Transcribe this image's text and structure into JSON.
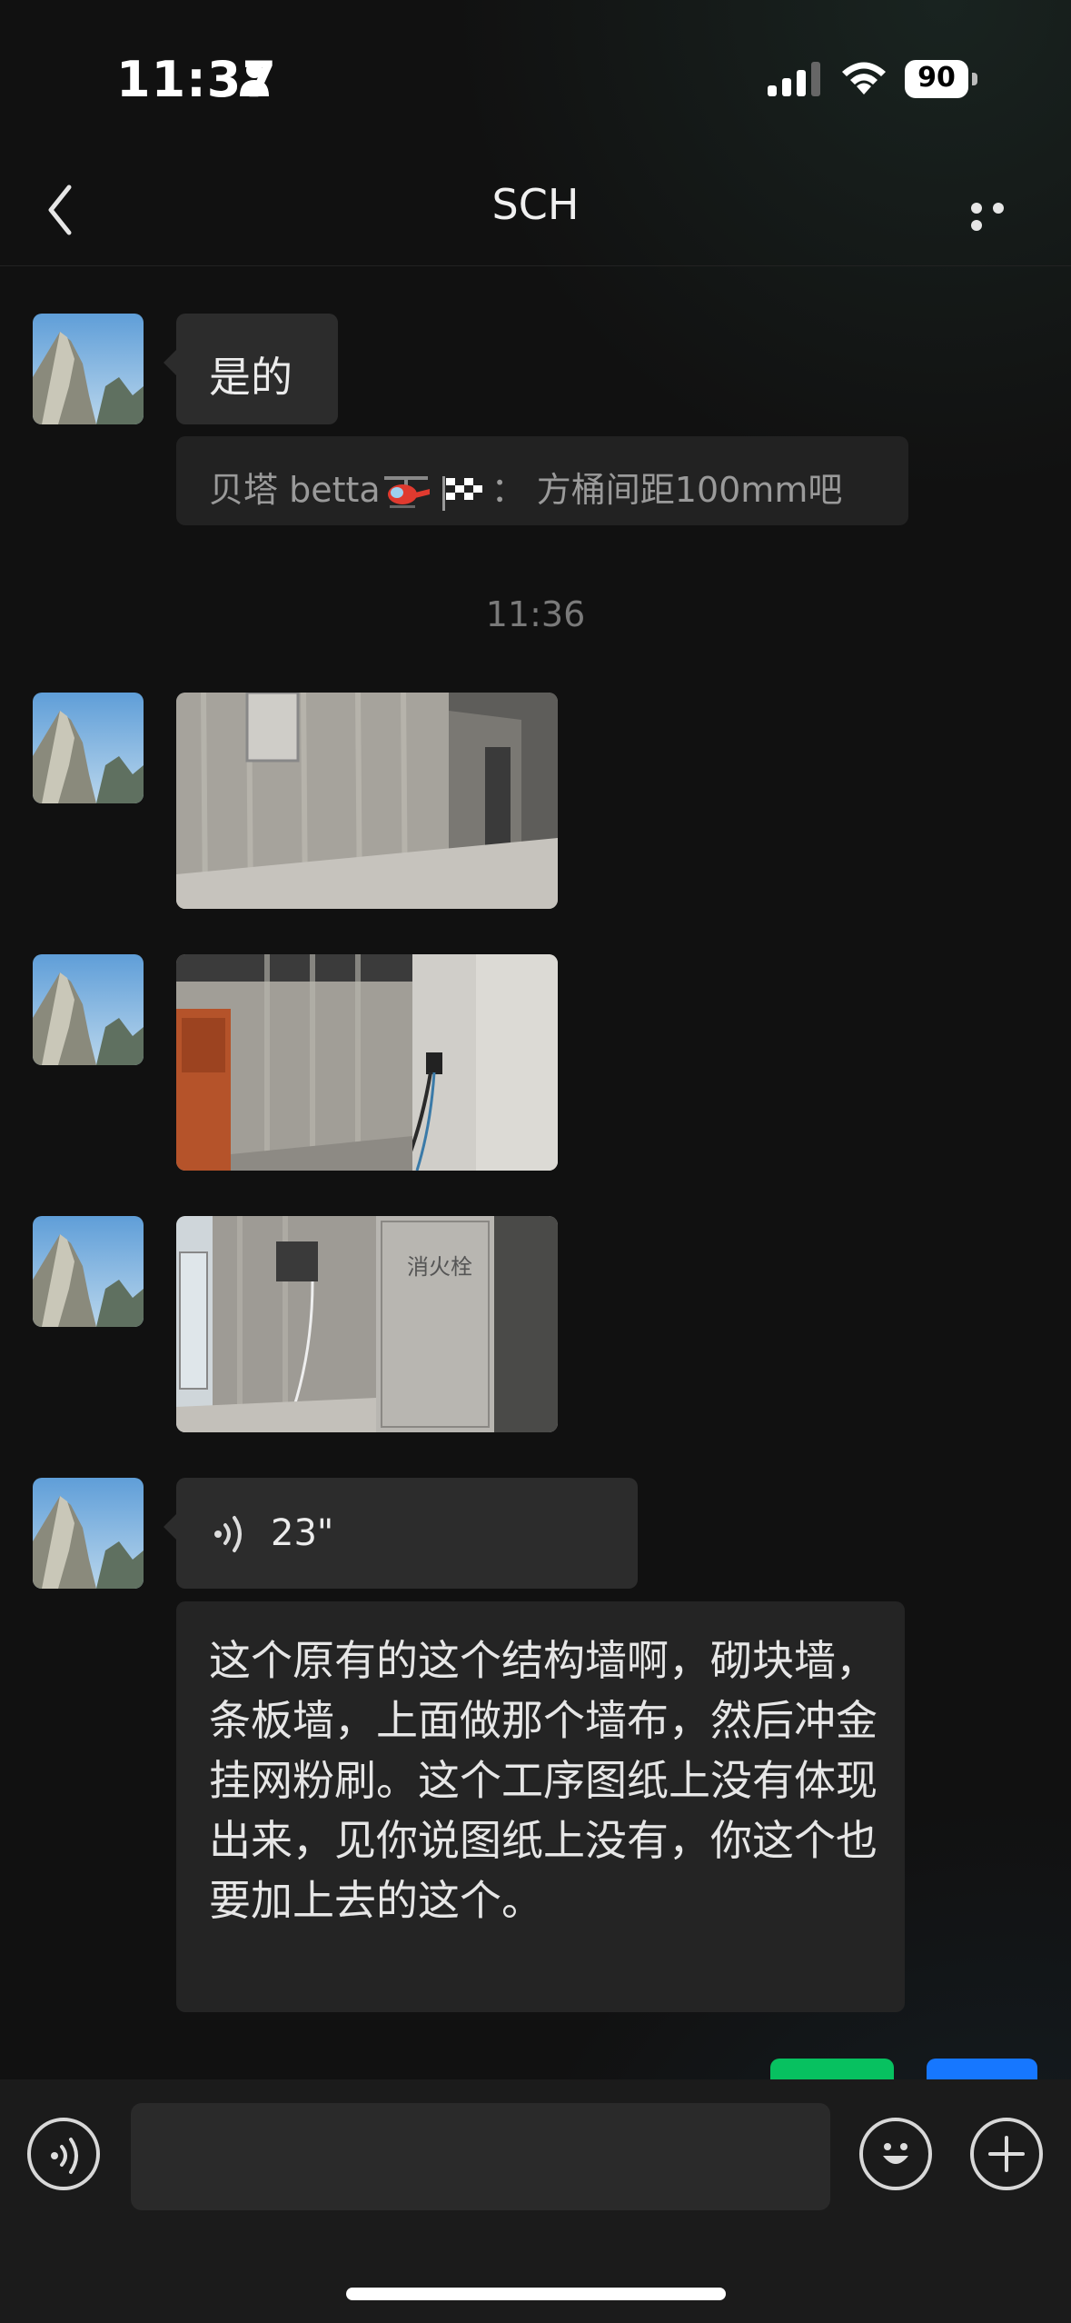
{
  "status_bar": {
    "time": "11:37",
    "battery": "90"
  },
  "nav": {
    "title": "SCH"
  },
  "messages": {
    "text1": "是的",
    "quote": {
      "sender": "贝塔 betta",
      "text": "方桶间距100mm吧"
    },
    "timestamp": "11:36",
    "voice_duration": "23\"",
    "transcript": "这个原有的这个结构墙啊，砌块墙，条板墙，上面做那个墙布，然后冲金挂网粉刷。这个工序图纸上没有体现出来，见你说图纸上没有，你这个也要加上去的这个。"
  },
  "photo3_sign": "消火栓",
  "colors": {
    "background": "#111111",
    "bubble": "#2c2c2c",
    "accent_green": "#07c160",
    "accent_blue": "#1677ff"
  }
}
